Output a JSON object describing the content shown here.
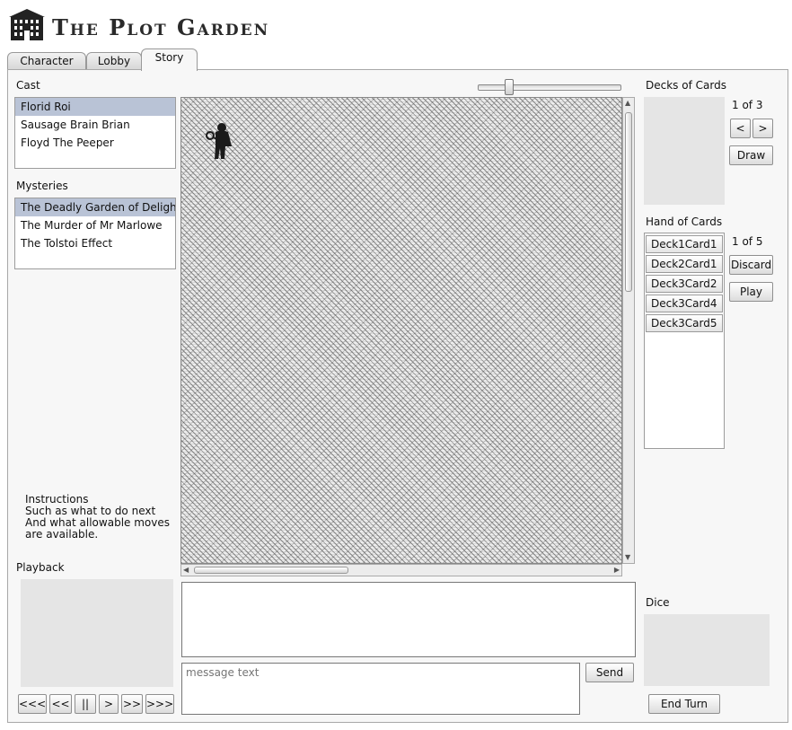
{
  "app": {
    "title": "The Plot Garden",
    "logo_icon": "building-icon"
  },
  "tabs": [
    {
      "label": "Character",
      "active": false
    },
    {
      "label": "Lobby",
      "active": false
    },
    {
      "label": "Story",
      "active": true
    }
  ],
  "cast": {
    "label": "Cast",
    "items": [
      "Florid Roi",
      "Sausage Brain Brian",
      "Floyd The Peeper"
    ],
    "selected_index": 0
  },
  "mysteries": {
    "label": "Mysteries",
    "items": [
      "The Deadly Garden of Delight",
      "The Murder of Mr Marlowe",
      "The Tolstoi Effect"
    ],
    "selected_index": 0
  },
  "instructions": {
    "title": "Instructions",
    "lines": [
      "Such as what to do next",
      "And what allowable moves",
      "are available."
    ]
  },
  "playback": {
    "label": "Playback",
    "controls": [
      "<<<",
      "<<",
      "||",
      ">",
      ">>",
      ">>>"
    ]
  },
  "map": {
    "zoom_fraction": 0.2,
    "player_icon": "detective-figure-icon"
  },
  "chat": {
    "message_placeholder": "message text",
    "send_label": "Send"
  },
  "decks": {
    "label": "Decks of Cards",
    "page": "1 of 3",
    "prev_label": "<",
    "next_label": ">",
    "draw_label": "Draw"
  },
  "hand": {
    "label": "Hand of Cards",
    "page": "1 of 5",
    "cards": [
      "Deck1Card1",
      "Deck2Card1",
      "Deck3Card2",
      "Deck3Card4",
      "Deck3Card5"
    ],
    "discard_label": "Discard",
    "play_label": "Play"
  },
  "dice": {
    "label": "Dice"
  },
  "end_turn_label": "End Turn"
}
